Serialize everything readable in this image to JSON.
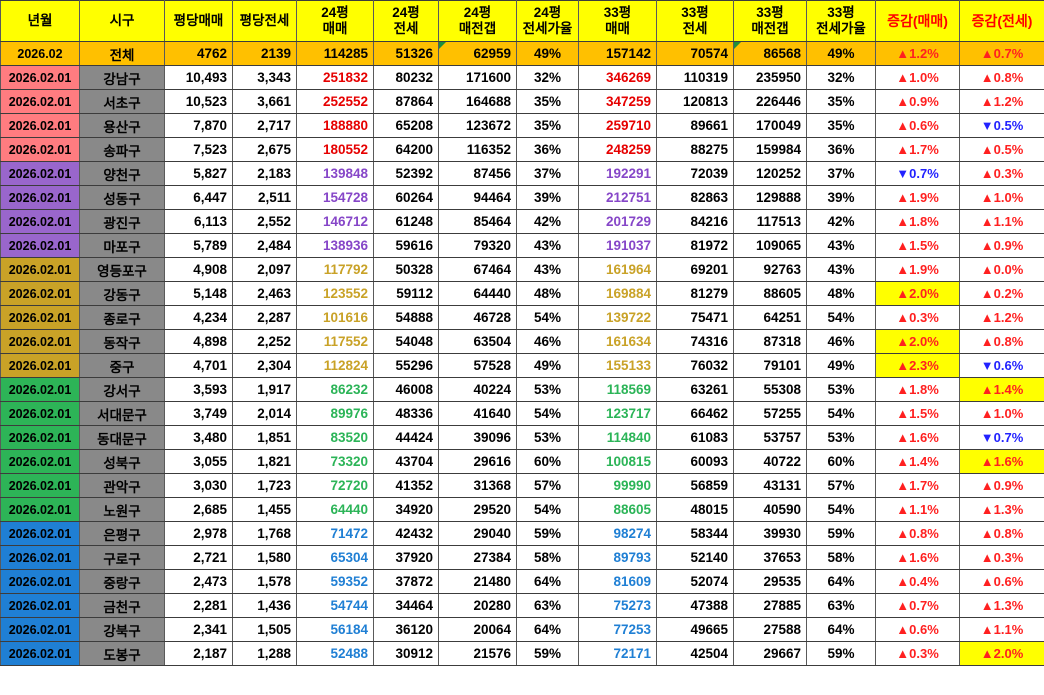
{
  "table": {
    "headers": [
      "년월",
      "시구",
      "평당매매",
      "평당전세",
      "24평\n매매",
      "24평\n전세",
      "24평\n매전갭",
      "24평\n전세가율",
      "33평\n매매",
      "33평\n전세",
      "33평\n매전갭",
      "33평\n전세가율",
      "증감(매매)",
      "증감(전세)"
    ],
    "total": {
      "date": "2026.02",
      "district": "전체",
      "values": [
        "4762",
        "2139",
        "114285",
        "51326",
        "62959",
        "49%",
        "157142",
        "70574",
        "86568",
        "49%"
      ],
      "chg_sale": "▲1.2%",
      "chg_jeonse": "▲0.7%"
    },
    "rows": [
      {
        "date": "2026.02.01",
        "district": "강남구",
        "group": "pink",
        "py_sale": "10,493",
        "py_jeonse": "3,343",
        "p24_sale": "251832",
        "p24_jeonse": "80232",
        "p24_gap": "171600",
        "p24_ratio": "32%",
        "p33_sale": "346269",
        "p33_jeonse": "110319",
        "p33_gap": "235950",
        "p33_ratio": "32%",
        "chg_sale": {
          "text": "▲1.0%",
          "dir": "up",
          "hl": false
        },
        "chg_jeonse": {
          "text": "▲0.8%",
          "dir": "up",
          "hl": false
        }
      },
      {
        "date": "2026.02.01",
        "district": "서초구",
        "group": "pink",
        "py_sale": "10,523",
        "py_jeonse": "3,661",
        "p24_sale": "252552",
        "p24_jeonse": "87864",
        "p24_gap": "164688",
        "p24_ratio": "35%",
        "p33_sale": "347259",
        "p33_jeonse": "120813",
        "p33_gap": "226446",
        "p33_ratio": "35%",
        "chg_sale": {
          "text": "▲0.9%",
          "dir": "up",
          "hl": false
        },
        "chg_jeonse": {
          "text": "▲1.2%",
          "dir": "up",
          "hl": false
        }
      },
      {
        "date": "2026.02.01",
        "district": "용산구",
        "group": "pink",
        "py_sale": "7,870",
        "py_jeonse": "2,717",
        "p24_sale": "188880",
        "p24_jeonse": "65208",
        "p24_gap": "123672",
        "p24_ratio": "35%",
        "p33_sale": "259710",
        "p33_jeonse": "89661",
        "p33_gap": "170049",
        "p33_ratio": "35%",
        "chg_sale": {
          "text": "▲0.6%",
          "dir": "up",
          "hl": false
        },
        "chg_jeonse": {
          "text": "▼0.5%",
          "dir": "down",
          "hl": false
        }
      },
      {
        "date": "2026.02.01",
        "district": "송파구",
        "group": "pink",
        "py_sale": "7,523",
        "py_jeonse": "2,675",
        "p24_sale": "180552",
        "p24_jeonse": "64200",
        "p24_gap": "116352",
        "p24_ratio": "36%",
        "p33_sale": "248259",
        "p33_jeonse": "88275",
        "p33_gap": "159984",
        "p33_ratio": "36%",
        "chg_sale": {
          "text": "▲1.7%",
          "dir": "up",
          "hl": false
        },
        "chg_jeonse": {
          "text": "▲0.5%",
          "dir": "up",
          "hl": false
        }
      },
      {
        "date": "2026.02.01",
        "district": "양천구",
        "group": "purple",
        "py_sale": "5,827",
        "py_jeonse": "2,183",
        "p24_sale": "139848",
        "p24_jeonse": "52392",
        "p24_gap": "87456",
        "p24_ratio": "37%",
        "p33_sale": "192291",
        "p33_jeonse": "72039",
        "p33_gap": "120252",
        "p33_ratio": "37%",
        "chg_sale": {
          "text": "▼0.7%",
          "dir": "down",
          "hl": false
        },
        "chg_jeonse": {
          "text": "▲0.3%",
          "dir": "up",
          "hl": false
        }
      },
      {
        "date": "2026.02.01",
        "district": "성동구",
        "group": "purple",
        "py_sale": "6,447",
        "py_jeonse": "2,511",
        "p24_sale": "154728",
        "p24_jeonse": "60264",
        "p24_gap": "94464",
        "p24_ratio": "39%",
        "p33_sale": "212751",
        "p33_jeonse": "82863",
        "p33_gap": "129888",
        "p33_ratio": "39%",
        "chg_sale": {
          "text": "▲1.9%",
          "dir": "up",
          "hl": false
        },
        "chg_jeonse": {
          "text": "▲1.0%",
          "dir": "up",
          "hl": false
        }
      },
      {
        "date": "2026.02.01",
        "district": "광진구",
        "group": "purple",
        "py_sale": "6,113",
        "py_jeonse": "2,552",
        "p24_sale": "146712",
        "p24_jeonse": "61248",
        "p24_gap": "85464",
        "p24_ratio": "42%",
        "p33_sale": "201729",
        "p33_jeonse": "84216",
        "p33_gap": "117513",
        "p33_ratio": "42%",
        "chg_sale": {
          "text": "▲1.8%",
          "dir": "up",
          "hl": false
        },
        "chg_jeonse": {
          "text": "▲1.1%",
          "dir": "up",
          "hl": false
        }
      },
      {
        "date": "2026.02.01",
        "district": "마포구",
        "group": "purple",
        "py_sale": "5,789",
        "py_jeonse": "2,484",
        "p24_sale": "138936",
        "p24_jeonse": "59616",
        "p24_gap": "79320",
        "p24_ratio": "43%",
        "p33_sale": "191037",
        "p33_jeonse": "81972",
        "p33_gap": "109065",
        "p33_ratio": "43%",
        "chg_sale": {
          "text": "▲1.5%",
          "dir": "up",
          "hl": false
        },
        "chg_jeonse": {
          "text": "▲0.9%",
          "dir": "up",
          "hl": false
        }
      },
      {
        "date": "2026.02.01",
        "district": "영등포구",
        "group": "gold",
        "py_sale": "4,908",
        "py_jeonse": "2,097",
        "p24_sale": "117792",
        "p24_jeonse": "50328",
        "p24_gap": "67464",
        "p24_ratio": "43%",
        "p33_sale": "161964",
        "p33_jeonse": "69201",
        "p33_gap": "92763",
        "p33_ratio": "43%",
        "chg_sale": {
          "text": "▲1.9%",
          "dir": "up",
          "hl": false
        },
        "chg_jeonse": {
          "text": "▲0.0%",
          "dir": "up",
          "hl": false
        }
      },
      {
        "date": "2026.02.01",
        "district": "강동구",
        "group": "gold",
        "py_sale": "5,148",
        "py_jeonse": "2,463",
        "p24_sale": "123552",
        "p24_jeonse": "59112",
        "p24_gap": "64440",
        "p24_ratio": "48%",
        "p33_sale": "169884",
        "p33_jeonse": "81279",
        "p33_gap": "88605",
        "p33_ratio": "48%",
        "chg_sale": {
          "text": "▲2.0%",
          "dir": "up",
          "hl": true
        },
        "chg_jeonse": {
          "text": "▲0.2%",
          "dir": "up",
          "hl": false
        }
      },
      {
        "date": "2026.02.01",
        "district": "종로구",
        "group": "gold",
        "py_sale": "4,234",
        "py_jeonse": "2,287",
        "p24_sale": "101616",
        "p24_jeonse": "54888",
        "p24_gap": "46728",
        "p24_ratio": "54%",
        "p33_sale": "139722",
        "p33_jeonse": "75471",
        "p33_gap": "64251",
        "p33_ratio": "54%",
        "chg_sale": {
          "text": "▲0.3%",
          "dir": "up",
          "hl": false
        },
        "chg_jeonse": {
          "text": "▲1.2%",
          "dir": "up",
          "hl": false
        }
      },
      {
        "date": "2026.02.01",
        "district": "동작구",
        "group": "gold",
        "py_sale": "4,898",
        "py_jeonse": "2,252",
        "p24_sale": "117552",
        "p24_jeonse": "54048",
        "p24_gap": "63504",
        "p24_ratio": "46%",
        "p33_sale": "161634",
        "p33_jeonse": "74316",
        "p33_gap": "87318",
        "p33_ratio": "46%",
        "chg_sale": {
          "text": "▲2.0%",
          "dir": "up",
          "hl": true
        },
        "chg_jeonse": {
          "text": "▲0.8%",
          "dir": "up",
          "hl": false
        }
      },
      {
        "date": "2026.02.01",
        "district": "중구",
        "group": "gold",
        "py_sale": "4,701",
        "py_jeonse": "2,304",
        "p24_sale": "112824",
        "p24_jeonse": "55296",
        "p24_gap": "57528",
        "p24_ratio": "49%",
        "p33_sale": "155133",
        "p33_jeonse": "76032",
        "p33_gap": "79101",
        "p33_ratio": "49%",
        "chg_sale": {
          "text": "▲2.3%",
          "dir": "up",
          "hl": true
        },
        "chg_jeonse": {
          "text": "▼0.6%",
          "dir": "down",
          "hl": false
        }
      },
      {
        "date": "2026.02.01",
        "district": "강서구",
        "group": "green",
        "py_sale": "3,593",
        "py_jeonse": "1,917",
        "p24_sale": "86232",
        "p24_jeonse": "46008",
        "p24_gap": "40224",
        "p24_ratio": "53%",
        "p33_sale": "118569",
        "p33_jeonse": "63261",
        "p33_gap": "55308",
        "p33_ratio": "53%",
        "chg_sale": {
          "text": "▲1.8%",
          "dir": "up",
          "hl": false
        },
        "chg_jeonse": {
          "text": "▲1.4%",
          "dir": "up",
          "hl": true
        }
      },
      {
        "date": "2026.02.01",
        "district": "서대문구",
        "group": "green",
        "py_sale": "3,749",
        "py_jeonse": "2,014",
        "p24_sale": "89976",
        "p24_jeonse": "48336",
        "p24_gap": "41640",
        "p24_ratio": "54%",
        "p33_sale": "123717",
        "p33_jeonse": "66462",
        "p33_gap": "57255",
        "p33_ratio": "54%",
        "chg_sale": {
          "text": "▲1.5%",
          "dir": "up",
          "hl": false
        },
        "chg_jeonse": {
          "text": "▲1.0%",
          "dir": "up",
          "hl": false
        }
      },
      {
        "date": "2026.02.01",
        "district": "동대문구",
        "group": "green",
        "py_sale": "3,480",
        "py_jeonse": "1,851",
        "p24_sale": "83520",
        "p24_jeonse": "44424",
        "p24_gap": "39096",
        "p24_ratio": "53%",
        "p33_sale": "114840",
        "p33_jeonse": "61083",
        "p33_gap": "53757",
        "p33_ratio": "53%",
        "chg_sale": {
          "text": "▲1.6%",
          "dir": "up",
          "hl": false
        },
        "chg_jeonse": {
          "text": "▼0.7%",
          "dir": "down",
          "hl": false
        }
      },
      {
        "date": "2026.02.01",
        "district": "성북구",
        "group": "green",
        "py_sale": "3,055",
        "py_jeonse": "1,821",
        "p24_sale": "73320",
        "p24_jeonse": "43704",
        "p24_gap": "29616",
        "p24_ratio": "60%",
        "p33_sale": "100815",
        "p33_jeonse": "60093",
        "p33_gap": "40722",
        "p33_ratio": "60%",
        "chg_sale": {
          "text": "▲1.4%",
          "dir": "up",
          "hl": false
        },
        "chg_jeonse": {
          "text": "▲1.6%",
          "dir": "up",
          "hl": true
        }
      },
      {
        "date": "2026.02.01",
        "district": "관악구",
        "group": "green",
        "py_sale": "3,030",
        "py_jeonse": "1,723",
        "p24_sale": "72720",
        "p24_jeonse": "41352",
        "p24_gap": "31368",
        "p24_ratio": "57%",
        "p33_sale": "99990",
        "p33_jeonse": "56859",
        "p33_gap": "43131",
        "p33_ratio": "57%",
        "chg_sale": {
          "text": "▲1.7%",
          "dir": "up",
          "hl": false
        },
        "chg_jeonse": {
          "text": "▲0.9%",
          "dir": "up",
          "hl": false
        }
      },
      {
        "date": "2026.02.01",
        "district": "노원구",
        "group": "green",
        "py_sale": "2,685",
        "py_jeonse": "1,455",
        "p24_sale": "64440",
        "p24_jeonse": "34920",
        "p24_gap": "29520",
        "p24_ratio": "54%",
        "p33_sale": "88605",
        "p33_jeonse": "48015",
        "p33_gap": "40590",
        "p33_ratio": "54%",
        "chg_sale": {
          "text": "▲1.1%",
          "dir": "up",
          "hl": false
        },
        "chg_jeonse": {
          "text": "▲1.3%",
          "dir": "up",
          "hl": false
        }
      },
      {
        "date": "2026.02.01",
        "district": "은평구",
        "group": "blue",
        "py_sale": "2,978",
        "py_jeonse": "1,768",
        "p24_sale": "71472",
        "p24_jeonse": "42432",
        "p24_gap": "29040",
        "p24_ratio": "59%",
        "p33_sale": "98274",
        "p33_jeonse": "58344",
        "p33_gap": "39930",
        "p33_ratio": "59%",
        "chg_sale": {
          "text": "▲0.8%",
          "dir": "up",
          "hl": false
        },
        "chg_jeonse": {
          "text": "▲0.8%",
          "dir": "up",
          "hl": false
        }
      },
      {
        "date": "2026.02.01",
        "district": "구로구",
        "group": "blue",
        "py_sale": "2,721",
        "py_jeonse": "1,580",
        "p24_sale": "65304",
        "p24_jeonse": "37920",
        "p24_gap": "27384",
        "p24_ratio": "58%",
        "p33_sale": "89793",
        "p33_jeonse": "52140",
        "p33_gap": "37653",
        "p33_ratio": "58%",
        "chg_sale": {
          "text": "▲1.6%",
          "dir": "up",
          "hl": false
        },
        "chg_jeonse": {
          "text": "▲0.3%",
          "dir": "up",
          "hl": false
        }
      },
      {
        "date": "2026.02.01",
        "district": "중랑구",
        "group": "blue",
        "py_sale": "2,473",
        "py_jeonse": "1,578",
        "p24_sale": "59352",
        "p24_jeonse": "37872",
        "p24_gap": "21480",
        "p24_ratio": "64%",
        "p33_sale": "81609",
        "p33_jeonse": "52074",
        "p33_gap": "29535",
        "p33_ratio": "64%",
        "chg_sale": {
          "text": "▲0.4%",
          "dir": "up",
          "hl": false
        },
        "chg_jeonse": {
          "text": "▲0.6%",
          "dir": "up",
          "hl": false
        }
      },
      {
        "date": "2026.02.01",
        "district": "금천구",
        "group": "blue",
        "py_sale": "2,281",
        "py_jeonse": "1,436",
        "p24_sale": "54744",
        "p24_jeonse": "34464",
        "p24_gap": "20280",
        "p24_ratio": "63%",
        "p33_sale": "75273",
        "p33_jeonse": "47388",
        "p33_gap": "27885",
        "p33_ratio": "63%",
        "chg_sale": {
          "text": "▲0.7%",
          "dir": "up",
          "hl": false
        },
        "chg_jeonse": {
          "text": "▲1.3%",
          "dir": "up",
          "hl": false
        }
      },
      {
        "date": "2026.02.01",
        "district": "강북구",
        "group": "blue",
        "py_sale": "2,341",
        "py_jeonse": "1,505",
        "p24_sale": "56184",
        "p24_jeonse": "36120",
        "p24_gap": "20064",
        "p24_ratio": "64%",
        "p33_sale": "77253",
        "p33_jeonse": "49665",
        "p33_gap": "27588",
        "p33_ratio": "64%",
        "chg_sale": {
          "text": "▲0.6%",
          "dir": "up",
          "hl": false
        },
        "chg_jeonse": {
          "text": "▲1.1%",
          "dir": "up",
          "hl": false
        }
      },
      {
        "date": "2026.02.01",
        "district": "도봉구",
        "group": "blue",
        "py_sale": "2,187",
        "py_jeonse": "1,288",
        "p24_sale": "52488",
        "p24_jeonse": "30912",
        "p24_gap": "21576",
        "p24_ratio": "59%",
        "p33_sale": "72171",
        "p33_jeonse": "42504",
        "p33_gap": "29667",
        "p33_ratio": "59%",
        "chg_sale": {
          "text": "▲0.3%",
          "dir": "up",
          "hl": false
        },
        "chg_jeonse": {
          "text": "▲2.0%",
          "dir": "up",
          "hl": true
        }
      }
    ]
  },
  "colors": {
    "header_bg": "#FFFF00",
    "header_red_text": "#FF0000",
    "total_bg": "#FFC000",
    "district_bg": "#898989",
    "up": "#FF2020",
    "down": "#2222FF",
    "highlight": "#FFFF00",
    "corner_marker": "#1E8E3E",
    "groups": {
      "pink": {
        "cell": "#FF7C80",
        "text": "#E60000"
      },
      "purple": {
        "cell": "#9966CC",
        "text": "#8646C8"
      },
      "gold": {
        "cell": "#C9A227",
        "text": "#C9A227"
      },
      "green": {
        "cell": "#2DB457",
        "text": "#2BB457"
      },
      "blue": {
        "cell": "#1F7FD4",
        "text": "#1F7FD4"
      }
    }
  }
}
